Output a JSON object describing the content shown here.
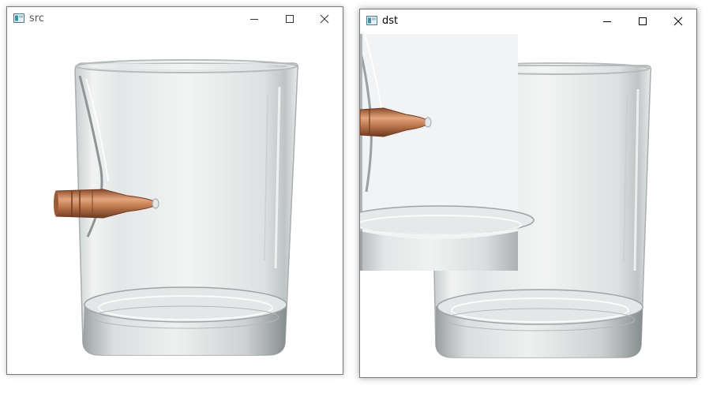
{
  "windows": [
    {
      "title": "src",
      "icon": "opencv-window-icon",
      "controls": [
        "minimize-icon",
        "maximize-icon",
        "close-icon"
      ]
    },
    {
      "title": "dst",
      "icon": "opencv-window-icon",
      "controls": [
        "minimize-icon",
        "maximize-icon",
        "close-icon"
      ]
    }
  ],
  "colors": {
    "window_border": "#7a7a7a",
    "title_text_src": "#555555",
    "title_text_dst": "#000000",
    "copper": "#b5754a",
    "glass": "#d8dcdd"
  }
}
